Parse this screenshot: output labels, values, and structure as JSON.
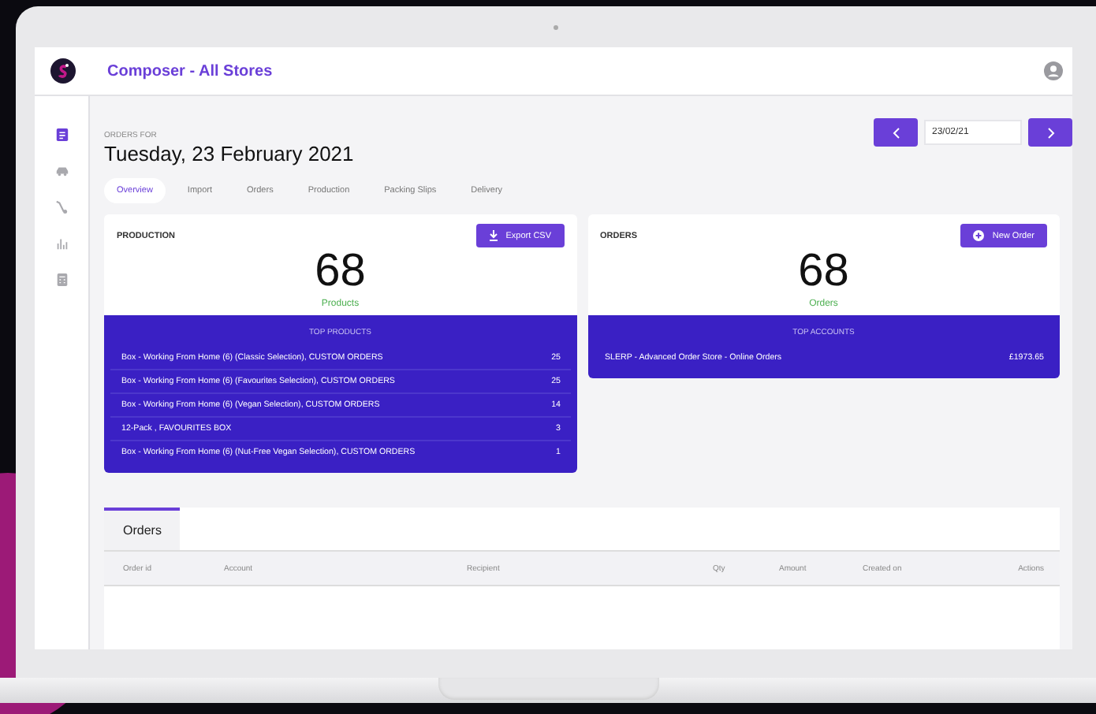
{
  "app_bar": {
    "title": "Composer - All Stores"
  },
  "sidebar": {
    "items": [
      {
        "selected": true
      },
      {
        "selected": false
      },
      {
        "selected": false
      },
      {
        "selected": false
      },
      {
        "selected": false
      }
    ]
  },
  "header": {
    "overline": "ORDERS FOR",
    "title": "Tuesday, 23 February 2021",
    "date": "23/02/21"
  },
  "tabs": [
    {
      "label": "Overview",
      "selected": true
    },
    {
      "label": "Import",
      "selected": false
    },
    {
      "label": "Orders",
      "selected": false
    },
    {
      "label": "Production",
      "selected": false
    },
    {
      "label": "Packing Slips",
      "selected": false
    },
    {
      "label": "Delivery",
      "selected": false
    }
  ],
  "cards": [
    {
      "kind": "export",
      "title": "PRODUCTION",
      "button": "Export CSV",
      "count": "68",
      "count_label": "Products",
      "list_title": "TOP PRODUCTS",
      "rows": [
        {
          "name": "Box - Working From Home (6) (Classic Selection), CUSTOM ORDERS",
          "value": "25"
        },
        {
          "name": "Box - Working From Home (6) (Favourites Selection), CUSTOM ORDERS",
          "value": "25"
        },
        {
          "name": "Box - Working From Home (6) (Vegan Selection), CUSTOM ORDERS",
          "value": "14"
        },
        {
          "name": "12-Pack , FAVOURITES BOX",
          "value": "3"
        },
        {
          "name": "Box - Working From Home (6) (Nut-Free Vegan Selection), CUSTOM ORDERS",
          "value": "1"
        }
      ]
    },
    {
      "kind": "new",
      "title": "ORDERS",
      "button": "New Order",
      "count": "68",
      "count_label": "Orders",
      "list_title": "TOP ACCOUNTS",
      "rows": [
        {
          "name": "SLERP - Advanced Order Store - Online Orders",
          "value": "£1973.65"
        }
      ]
    }
  ],
  "orders_panel": {
    "tabs": [
      {
        "label": "Orders",
        "selected": true
      }
    ],
    "columns": [
      "Order id",
      "Account",
      "Recipient",
      "Qty",
      "Amount",
      "Created on",
      "Actions"
    ]
  }
}
